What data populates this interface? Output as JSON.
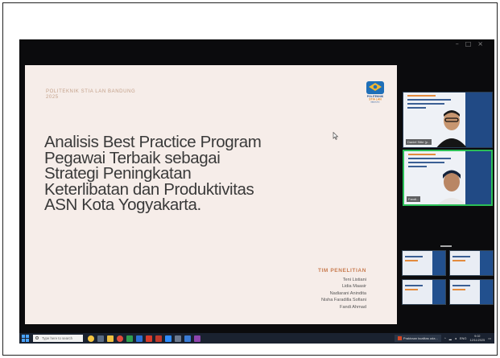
{
  "window": {
    "controls": [
      "–",
      "□",
      "×"
    ]
  },
  "slide": {
    "org_line1": "POLITEKNIK STIA LAN BANDUNG",
    "org_line2": "2025",
    "logo_text1": "POLITEKNIK",
    "logo_text2": "STIA LAN",
    "logo_text3": "BANDUNG",
    "title_lines": [
      "Analisis Best Practice Program",
      "Pegawai Terbaik sebagai",
      "Strategi Peningkatan",
      "Keterlibatan dan  Produktivitas",
      "ASN Kota Yogyakarta."
    ],
    "team_heading": "TIM PENELITIAN",
    "team_members": [
      "Teni Listiani",
      "Lidia Maasir",
      "Nadiarani Anindita",
      "Nisha  Faradilla Sofiani",
      "Fandi Ahmad"
    ]
  },
  "participants": [
    {
      "label": "Daniel Sitte (p..."
    },
    {
      "label": "Fandi..."
    }
  ],
  "taskbar": {
    "search_placeholder": "Type here to search",
    "ppt_label": "Prakiraan kualitas uda...",
    "lang": "ENG",
    "time": "9:02",
    "date": "12/11/2025"
  },
  "colors": {
    "slide_bg": "#f6ede9",
    "accent_orange": "#c87c50",
    "screen_bg": "#0b0b0d",
    "active_speaker": "#2bbf57"
  }
}
